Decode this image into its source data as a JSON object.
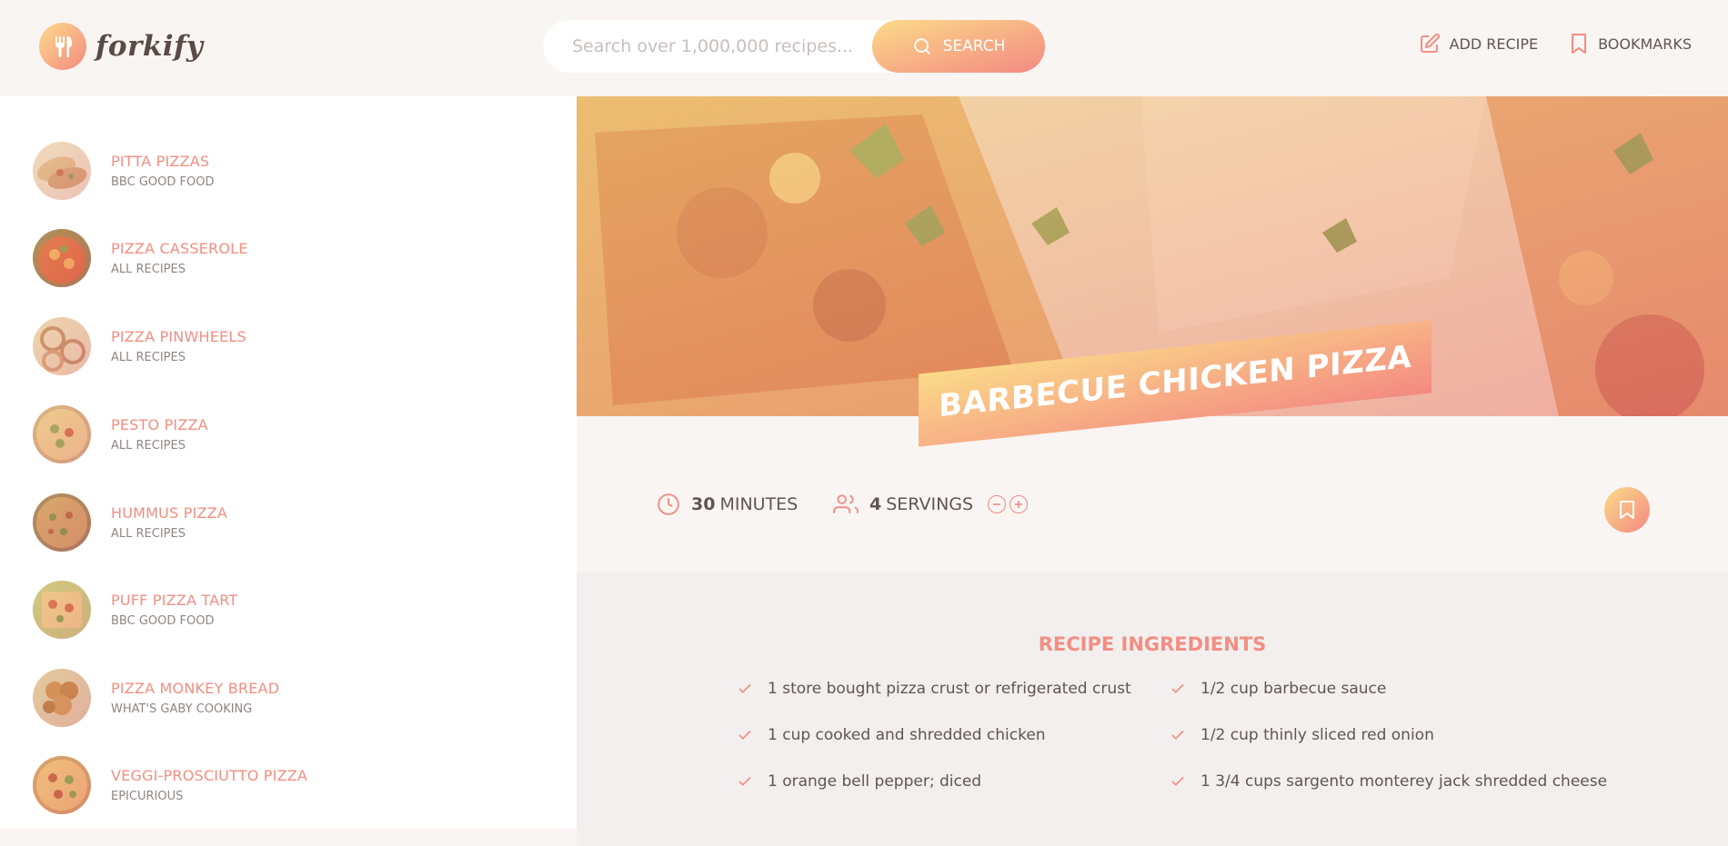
{
  "header": {
    "logo_text": "forkify",
    "search": {
      "placeholder": "Search over 1,000,000 recipes...",
      "button_label": "SEARCH"
    },
    "nav": {
      "add_recipe": "ADD RECIPE",
      "bookmarks": "BOOKMARKS"
    }
  },
  "sidebar": {
    "results": [
      {
        "title": "PITTA PIZZAS",
        "publisher": "BBC GOOD FOOD"
      },
      {
        "title": "PIZZA CASSEROLE",
        "publisher": "ALL RECIPES"
      },
      {
        "title": "PIZZA PINWHEELS",
        "publisher": "ALL RECIPES"
      },
      {
        "title": "PESTO PIZZA",
        "publisher": "ALL RECIPES"
      },
      {
        "title": "HUMMUS PIZZA",
        "publisher": "ALL RECIPES"
      },
      {
        "title": "PUFF PIZZA TART",
        "publisher": "BBC GOOD FOOD"
      },
      {
        "title": "PIZZA MONKEY BREAD",
        "publisher": "WHAT'S GABY COOKING"
      },
      {
        "title": "VEGGI-PROSCIUTTO PIZZA",
        "publisher": "EPICURIOUS"
      }
    ]
  },
  "recipe": {
    "title": "BARBECUE CHICKEN PIZZA",
    "cooking_time": "30",
    "cooking_time_unit": "MINUTES",
    "servings": "4",
    "servings_unit": "SERVINGS",
    "ingredients_heading": "RECIPE INGREDIENTS",
    "ingredients": [
      "1 store bought pizza crust or refrigerated crust",
      "1/2 cup barbecue sauce",
      "1 cup cooked and shredded chicken",
      "1/2 cup thinly sliced red onion",
      "1 orange bell pepper; diced",
      "1 3/4 cups sargento monterey jack shredded cheese"
    ]
  },
  "colors": {
    "accent": "#f38e82",
    "gradient_start": "#fbdb89",
    "gradient_end": "#f48982",
    "text": "#615551",
    "background": "#f9f5f3"
  }
}
